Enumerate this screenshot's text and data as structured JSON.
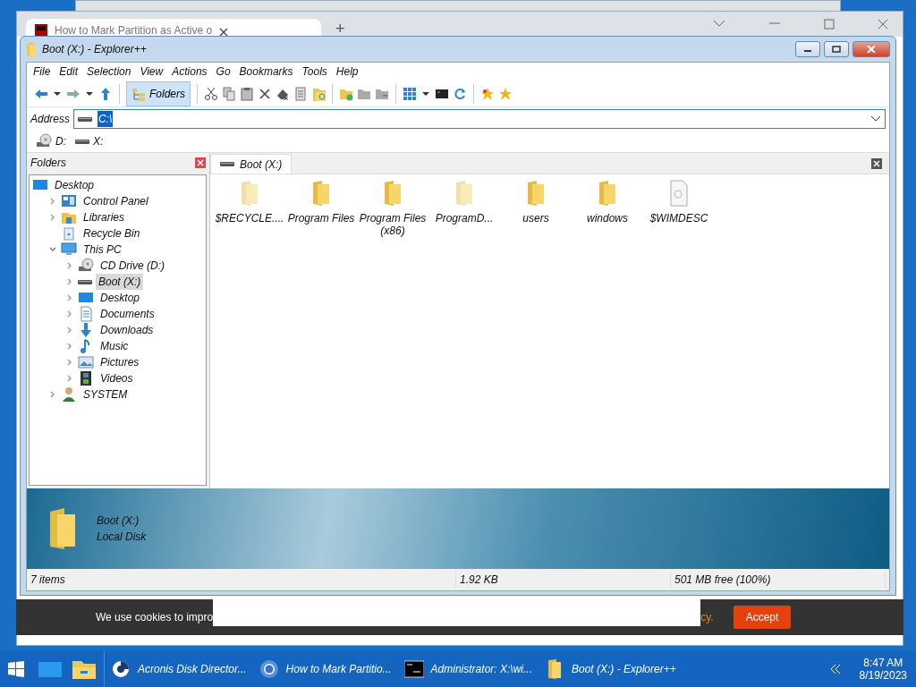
{
  "browser": {
    "tab_title": "How to Mark Partition as Active o",
    "new_tab": "+"
  },
  "explorer": {
    "title": "Boot (X:) - Explorer++",
    "menu": [
      "File",
      "Edit",
      "Selection",
      "View",
      "Actions",
      "Go",
      "Bookmarks",
      "Tools",
      "Help"
    ],
    "toolbar": {
      "folders_label": "Folders",
      "folders_selected": true
    },
    "address": {
      "label": "Address",
      "value": "C:\\"
    },
    "drives": [
      {
        "label": "D:",
        "kind": "cd"
      },
      {
        "label": "X:",
        "kind": "drive"
      }
    ],
    "folders_pane": {
      "title": "Folders",
      "tree": [
        {
          "label": "Desktop",
          "kind": "desktop",
          "selected": false,
          "children": [
            {
              "label": "Control Panel",
              "kind": "control",
              "expanded": false,
              "selected": false
            },
            {
              "label": "Libraries",
              "kind": "libraries",
              "expanded": false,
              "selected": false
            },
            {
              "label": "Recycle Bin",
              "kind": "recycle",
              "selected": false
            },
            {
              "label": "This PC",
              "kind": "pc",
              "expanded": true,
              "selected": false,
              "children": [
                {
                  "label": "CD Drive (D:)",
                  "kind": "cd",
                  "expanded": false,
                  "selected": false
                },
                {
                  "label": "Boot (X:)",
                  "kind": "drive",
                  "expanded": false,
                  "selected": true
                },
                {
                  "label": "Desktop",
                  "kind": "desktop",
                  "expanded": false,
                  "selected": false
                },
                {
                  "label": "Documents",
                  "kind": "documents",
                  "expanded": false,
                  "selected": false
                },
                {
                  "label": "Downloads",
                  "kind": "downloads",
                  "expanded": false,
                  "selected": false
                },
                {
                  "label": "Music",
                  "kind": "music",
                  "expanded": false,
                  "selected": false
                },
                {
                  "label": "Pictures",
                  "kind": "pictures",
                  "expanded": false,
                  "selected": false
                },
                {
                  "label": "Videos",
                  "kind": "videos",
                  "expanded": false,
                  "selected": false
                }
              ]
            },
            {
              "label": "SYSTEM",
              "kind": "user",
              "expanded": false,
              "selected": false
            }
          ]
        }
      ]
    },
    "tab": {
      "label": "Boot (X:)"
    },
    "files": [
      {
        "name": "$RECYCLE....",
        "kind": "folder",
        "hidden": true
      },
      {
        "name": "Program Files",
        "kind": "folder",
        "hidden": false
      },
      {
        "name": "Program Files (x86)",
        "kind": "folder",
        "hidden": false
      },
      {
        "name": "ProgramD...",
        "kind": "folder",
        "hidden": true
      },
      {
        "name": "users",
        "kind": "folder",
        "hidden": false
      },
      {
        "name": "windows",
        "kind": "folder",
        "hidden": false
      },
      {
        "name": "$WIMDESC",
        "kind": "file",
        "hidden": false
      }
    ],
    "info": {
      "name": "Boot (X:)",
      "type": "Local Disk"
    },
    "status_bar": [
      "7 items",
      "1.92 KB",
      "501 MB free (100%)"
    ]
  },
  "cookie_bar": {
    "text_start": "We use cookies to impro",
    "text_end": "cy.",
    "button": "Accept"
  },
  "taskbar": {
    "items": [
      {
        "label": "Acronis Disk Director...",
        "kind": "acronis"
      },
      {
        "label": "How to Mark Partitio...",
        "kind": "browser"
      },
      {
        "label": "Administrator: X:\\wi...",
        "kind": "console"
      },
      {
        "label": "Boot (X:) - Explorer++",
        "kind": "folder"
      }
    ],
    "time": "8:47 AM",
    "date": "8/19/2023"
  }
}
